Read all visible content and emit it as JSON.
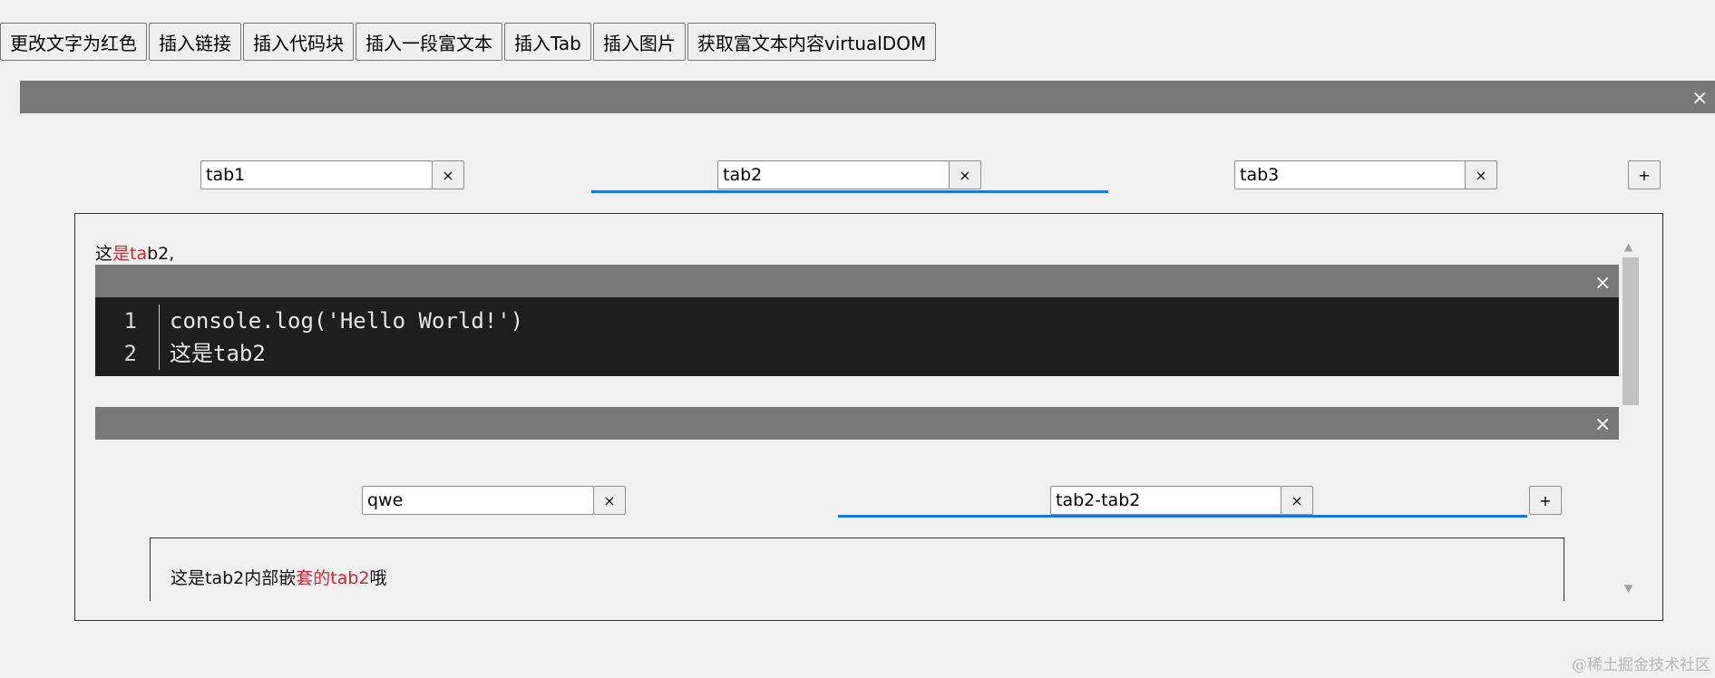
{
  "toolbar": {
    "buttons": [
      "更改文字为红色",
      "插入链接",
      "插入代码块",
      "插入一段富文本",
      "插入Tab",
      "插入图片",
      "获取富文本内容virtualDOM"
    ]
  },
  "close_glyph": "×",
  "add_glyph": "+",
  "outer_tabs": {
    "tabs": [
      "tab1",
      "tab2",
      "tab3"
    ],
    "active_index": 1
  },
  "tab2_content": {
    "line_plain_1": "这",
    "line_red": "是ta",
    "line_plain_2": "b2,"
  },
  "code_block": {
    "lines": [
      {
        "no": "1",
        "text": "console.log('Hello World!')"
      },
      {
        "no": "2",
        "text": "这是tab2"
      }
    ]
  },
  "inner_tabs": {
    "tabs": [
      "qwe",
      "tab2-tab2"
    ],
    "active_index": 1
  },
  "inner_content": {
    "plain_1": "这是tab2内部嵌",
    "red": "套的tab2",
    "plain_2": "哦"
  },
  "scrollbar": {
    "up_arrow": "▲",
    "down_arrow": "▼"
  },
  "watermark": "@稀土掘金技术社区",
  "colors": {
    "bar": "#787878",
    "code_bg": "#1e1e1e",
    "active_underline": "#1a73e8",
    "red_text": "#d0262f"
  }
}
